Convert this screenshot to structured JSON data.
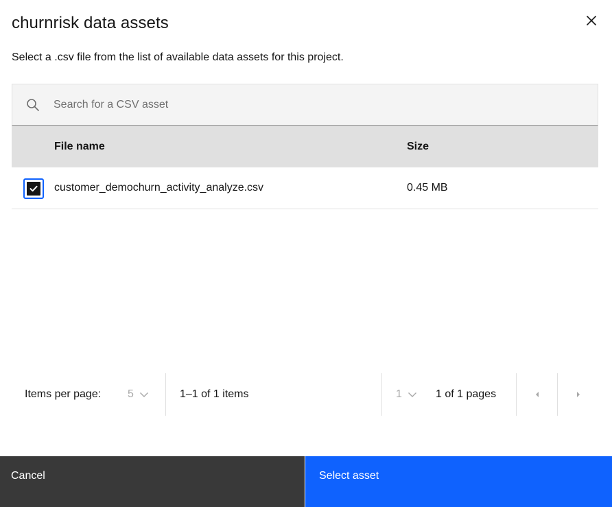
{
  "modal": {
    "title": "churnrisk data assets",
    "description": "Select a .csv file from the list of available data assets for this project."
  },
  "search": {
    "placeholder": "Search for a CSV asset",
    "value": ""
  },
  "table": {
    "headers": [
      "File name",
      "Size"
    ],
    "rows": [
      {
        "selected": true,
        "file_name": "customer_demochurn_activity_analyze.csv",
        "size": "0.45 MB"
      }
    ]
  },
  "pagination": {
    "items_per_page_label": "Items per page:",
    "items_per_page_value": "5",
    "range_text": "1–1 of 1 items",
    "page_value": "1",
    "pages_text": "1 of 1 pages"
  },
  "footer": {
    "cancel_label": "Cancel",
    "primary_label": "Select asset"
  },
  "colors": {
    "primary": "#0f62fe",
    "secondary": "#393939",
    "header_bg": "#e0e0e0",
    "search_bg": "#f4f4f4"
  },
  "icons": [
    "close-icon",
    "search-icon",
    "checkmark-icon",
    "chevron-down-icon",
    "caret-left-icon",
    "caret-right-icon"
  ]
}
